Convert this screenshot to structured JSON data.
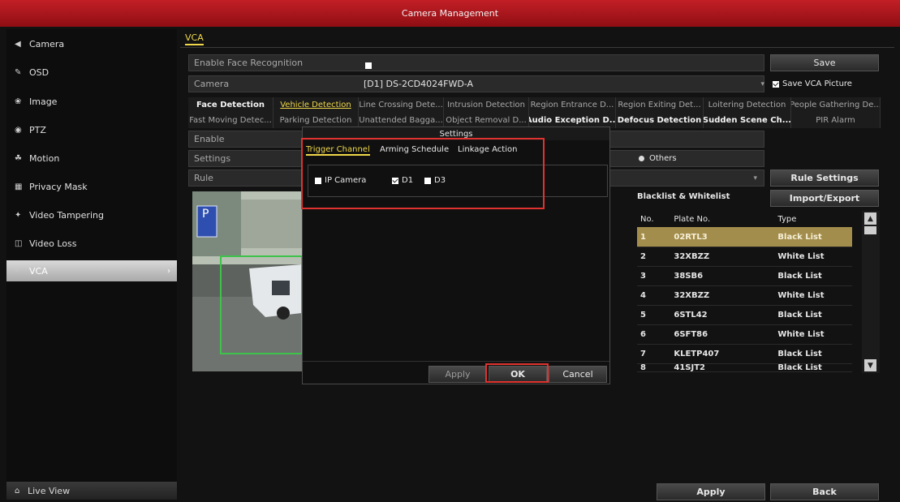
{
  "window": {
    "title": "Camera Management"
  },
  "sidebar": {
    "items": [
      {
        "label": "Camera",
        "icon": "camera-icon",
        "glyph": "◀"
      },
      {
        "label": "OSD",
        "icon": "osd-icon",
        "glyph": "✎"
      },
      {
        "label": "Image",
        "icon": "image-icon",
        "glyph": "❀"
      },
      {
        "label": "PTZ",
        "icon": "ptz-icon",
        "glyph": "◉"
      },
      {
        "label": "Motion",
        "icon": "motion-icon",
        "glyph": "☘"
      },
      {
        "label": "Privacy Mask",
        "icon": "privacy-mask-icon",
        "glyph": "▦"
      },
      {
        "label": "Video Tampering",
        "icon": "video-tampering-icon",
        "glyph": "✦"
      },
      {
        "label": "Video Loss",
        "icon": "video-loss-icon",
        "glyph": "◫"
      },
      {
        "label": "VCA",
        "icon": "vca-icon",
        "glyph": "◦",
        "active": true
      }
    ],
    "live_view": "Live View"
  },
  "main": {
    "tab": "VCA",
    "enable_face_recognition": "Enable Face Recognition",
    "save_button": "Save",
    "camera_label": "Camera",
    "camera_value": "[D1] DS-2CD4024FWD-A",
    "save_vca_picture": "Save VCA Picture",
    "detection_tabs_row1": [
      "Face Detection",
      "Vehicle Detection",
      "Line Crossing Dete...",
      "Intrusion Detection",
      "Region Entrance D...",
      "Region Exiting Det...",
      "Loitering Detection",
      "People Gathering De..."
    ],
    "detection_tabs_row2": [
      "Fast Moving Detec...",
      "Parking Detection",
      "Unattended Bagga...",
      "Object Removal D...",
      "Audio Exception D...",
      "Defocus Detection",
      "Sudden Scene Ch...",
      "PIR Alarm"
    ],
    "enable_label": "Enable",
    "settings_label": "Settings",
    "others_label": "Others",
    "rule_label": "Rule",
    "rule_settings_button": "Rule Settings",
    "blacklist_label": "Blacklist & Whitelist",
    "import_export_button": "Import/Export",
    "table": {
      "headers": [
        "No.",
        "Plate No.",
        "Type"
      ],
      "rows": [
        {
          "no": "1",
          "plate": "02RTL3",
          "type": "Black List"
        },
        {
          "no": "2",
          "plate": "32XBZZ",
          "type": "White List"
        },
        {
          "no": "3",
          "plate": "38SB6",
          "type": "Black List"
        },
        {
          "no": "4",
          "plate": "32XBZZ",
          "type": "White List"
        },
        {
          "no": "5",
          "plate": "6STL42",
          "type": "Black List"
        },
        {
          "no": "6",
          "plate": "6SFT86",
          "type": "White List"
        },
        {
          "no": "7",
          "plate": "KLETP407",
          "type": "Black List"
        },
        {
          "no": "8",
          "plate": "41SJT2",
          "type": "Black List"
        }
      ]
    },
    "apply_button": "Apply",
    "back_button": "Back"
  },
  "dialog": {
    "title": "Settings",
    "tabs": [
      "Trigger Channel",
      "Arming Schedule",
      "Linkage Action"
    ],
    "ip_camera": "IP Camera",
    "d1": "D1",
    "d3": "D3",
    "apply": "Apply",
    "ok": "OK",
    "cancel": "Cancel"
  },
  "colors": {
    "titlebar": "#b8191f",
    "accent": "#f0d84a",
    "highlight": "#e0322e"
  }
}
